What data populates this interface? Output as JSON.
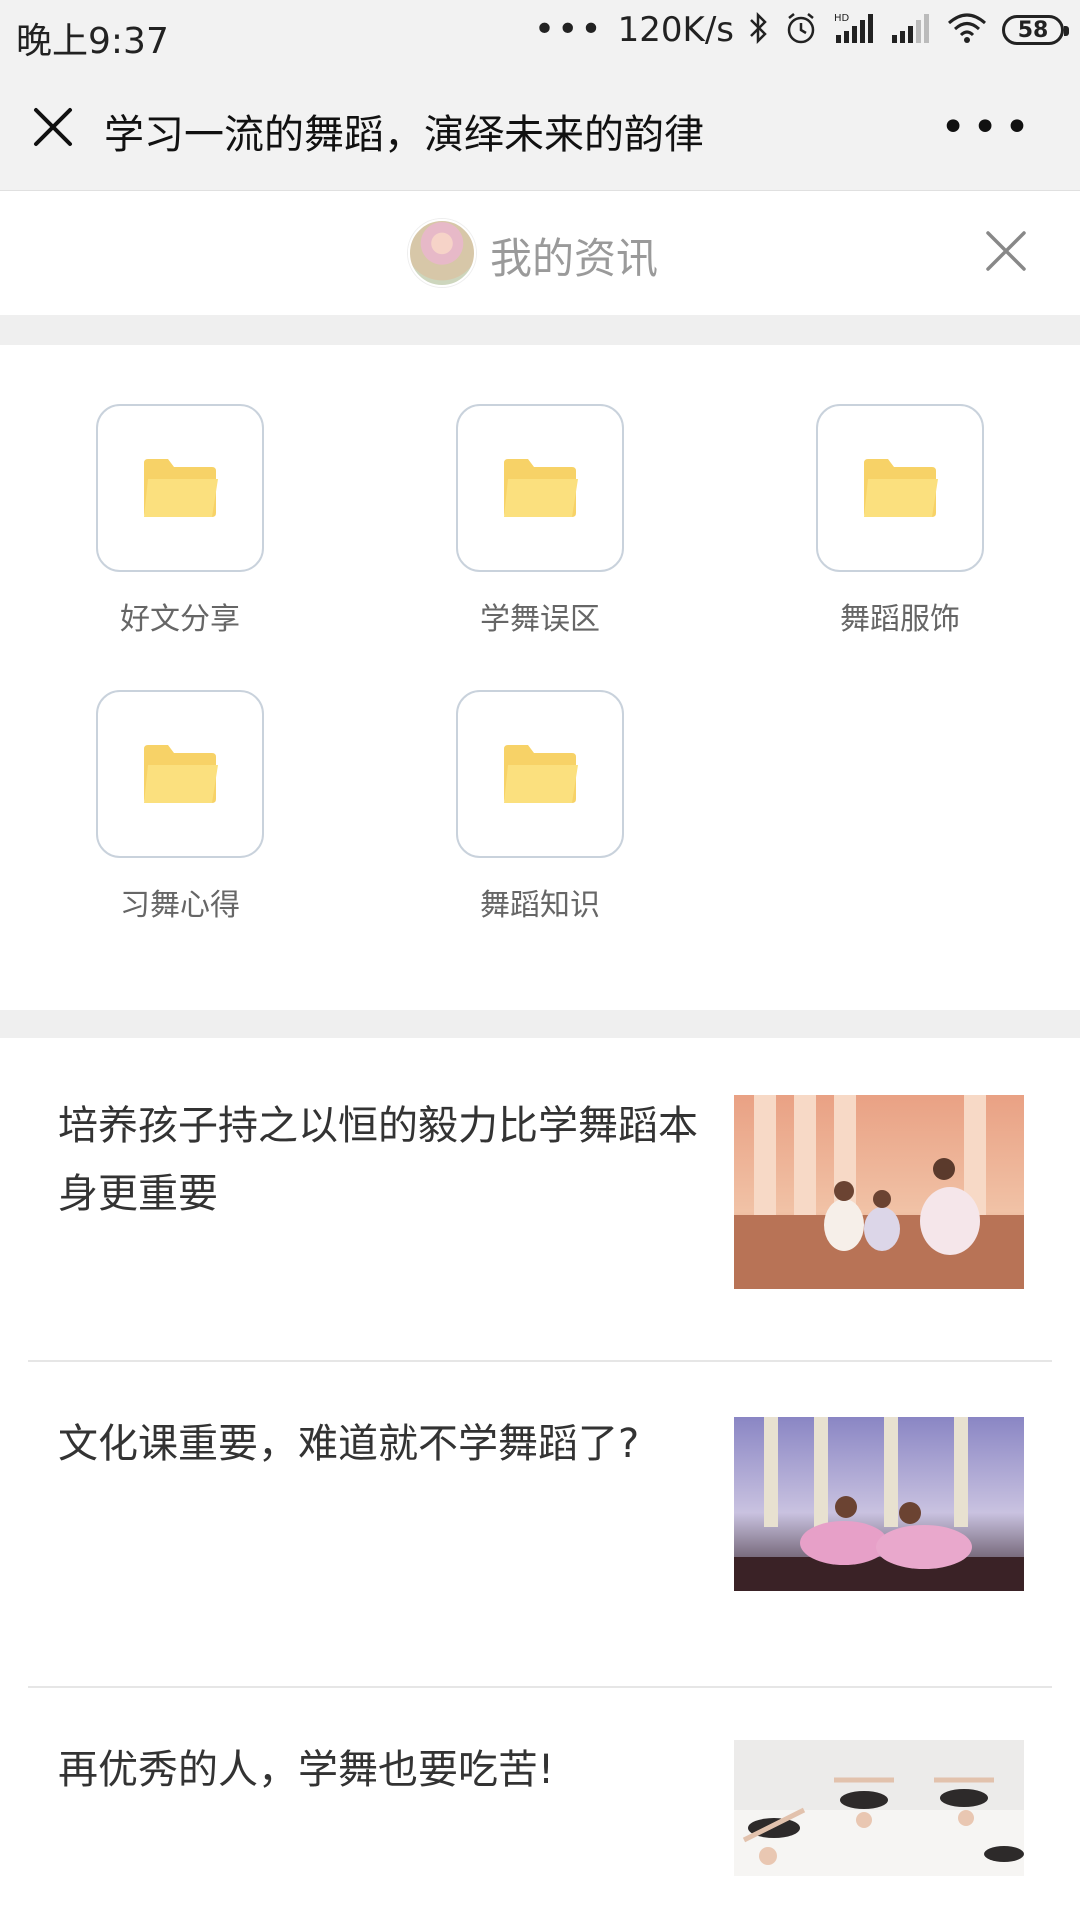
{
  "status_bar": {
    "time": "晚上9:37",
    "dots": "•••",
    "speed": "120K/s",
    "battery": "58",
    "icons": [
      "bluetooth-icon",
      "alarm-icon",
      "hd-signal-icon",
      "signal-icon",
      "wifi-icon",
      "battery-icon"
    ]
  },
  "title_bar": {
    "title": "学习一流的舞蹈，演绎未来的韵律",
    "more": "•••"
  },
  "header": {
    "title": "我的资讯"
  },
  "categories": [
    {
      "label": "好文分享"
    },
    {
      "label": "学舞误区"
    },
    {
      "label": "舞蹈服饰"
    },
    {
      "label": "习舞心得"
    },
    {
      "label": "舞蹈知识"
    }
  ],
  "articles": [
    {
      "title": "培养孩子持之以恒的毅力比学舞蹈本身更重要"
    },
    {
      "title": "文化课重要，难道就不学舞蹈了?"
    },
    {
      "title": "再优秀的人，学舞也要吃苦!"
    }
  ],
  "colors": {
    "folder": "#fbe07e",
    "folder_tab": "#f7d267",
    "tile_border": "#c9d2dc",
    "page_gray": "#efefef"
  }
}
